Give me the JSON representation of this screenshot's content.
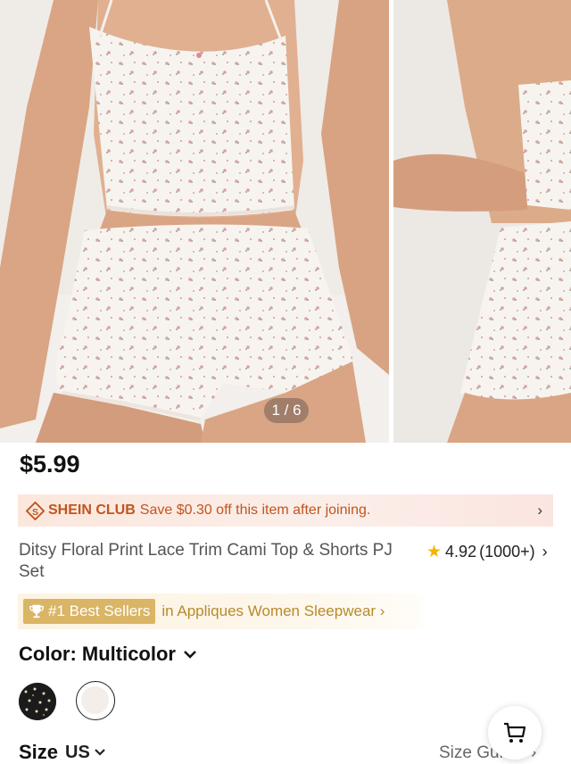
{
  "gallery": {
    "images": [
      {
        "description": "Model wearing ditsy floral lace trim cami top and shorts, front view"
      },
      {
        "description": "Model wearing the set, side view"
      }
    ],
    "counter": "1 / 6"
  },
  "product": {
    "price": "$5.99",
    "title": "Ditsy Floral Print Lace Trim Cami Top & Shorts PJ Set",
    "rating": "4.92",
    "rating_count": "(1000+)"
  },
  "club": {
    "brand": "SHEIN CLUB",
    "text": "Save $0.30 off this item after joining."
  },
  "best_sellers": {
    "badge": "#1 Best Sellers",
    "category": "in Appliques Women Sleepwear"
  },
  "color": {
    "label": "Color: Multicolor",
    "swatches": [
      {
        "name": "black-floral"
      },
      {
        "name": "white-floral",
        "selected": true
      }
    ]
  },
  "size": {
    "label": "Size",
    "unit": "US",
    "guide": "Size Guide"
  },
  "colors": {
    "club_accent": "#c2541f",
    "best_badge": "#d9b565",
    "star": "#f5b400"
  },
  "icons": [
    "shein-club-logo-icon",
    "chevron-right-icon",
    "star-icon",
    "trophy-icon",
    "chevron-down-icon",
    "cart-icon"
  ]
}
